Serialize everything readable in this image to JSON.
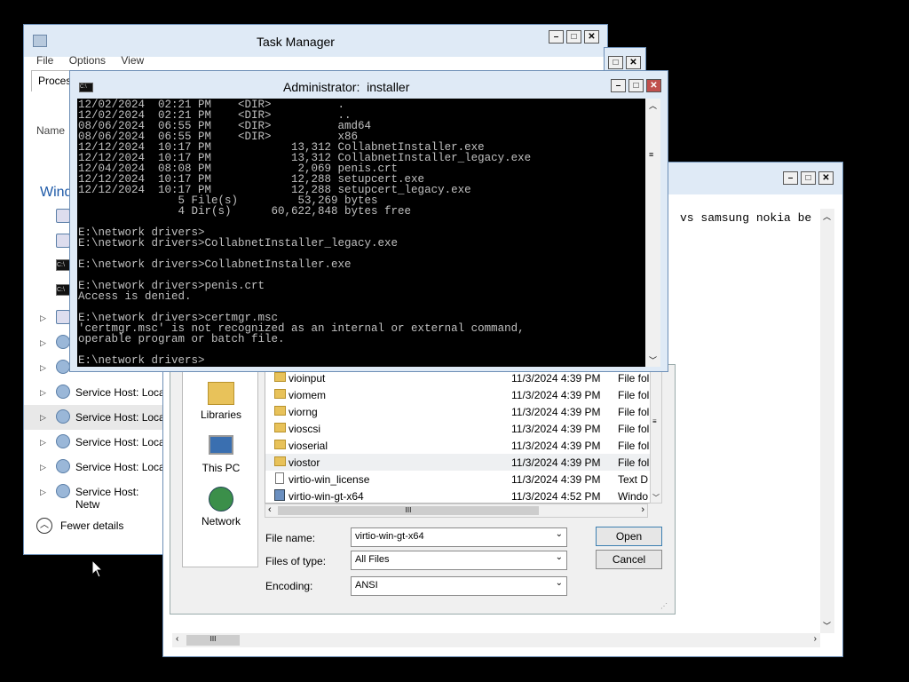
{
  "task_manager": {
    "title": "Task Manager",
    "menu": [
      "File",
      "Options",
      "View"
    ],
    "tab_partial": "Proces",
    "col_name": "Name",
    "group_partial": "Wind",
    "processes": [
      {
        "label": "Service Host: Loca"
      },
      {
        "label": "Service Host: Loca"
      },
      {
        "label": "Service Host: Loca"
      },
      {
        "label": "Service Host: Loca"
      },
      {
        "label": "Service Host: Netw"
      }
    ],
    "fewer_details": "Fewer details"
  },
  "notepad": {
    "text": "vs samsung nokia be"
  },
  "open_dialog": {
    "places": [
      {
        "label": "Libraries",
        "icon": "libraries-icon"
      },
      {
        "label": "This PC",
        "icon": "this-pc-icon"
      },
      {
        "label": "Network",
        "icon": "network-icon"
      }
    ],
    "files": [
      {
        "name": "vioinput",
        "date": "11/3/2024 4:39 PM",
        "type": "File fol",
        "icon": "folder"
      },
      {
        "name": "viomem",
        "date": "11/3/2024 4:39 PM",
        "type": "File fol",
        "icon": "folder"
      },
      {
        "name": "viorng",
        "date": "11/3/2024 4:39 PM",
        "type": "File fol",
        "icon": "folder"
      },
      {
        "name": "vioscsi",
        "date": "11/3/2024 4:39 PM",
        "type": "File fol",
        "icon": "folder"
      },
      {
        "name": "vioserial",
        "date": "11/3/2024 4:39 PM",
        "type": "File fol",
        "icon": "folder"
      },
      {
        "name": "viostor",
        "date": "11/3/2024 4:39 PM",
        "type": "File fol",
        "icon": "folder"
      },
      {
        "name": "virtio-win_license",
        "date": "11/3/2024 4:39 PM",
        "type": "Text D",
        "icon": "text-file"
      },
      {
        "name": "virtio-win-gt-x64",
        "date": "11/3/2024 4:52 PM",
        "type": "Windo",
        "icon": "installer"
      }
    ],
    "file_name_label": "File name:",
    "file_name_value": "virtio-win-gt-x64",
    "files_of_type_label": "Files of type:",
    "files_of_type_value": "All Files",
    "encoding_label": "Encoding:",
    "encoding_value": "ANSI",
    "open_label": "Open",
    "cancel_label": "Cancel"
  },
  "cmd": {
    "title": "Administrator:  installer",
    "lines": [
      "12/02/2024  02:21 PM    <DIR>          .",
      "12/02/2024  02:21 PM    <DIR>          ..",
      "08/06/2024  06:55 PM    <DIR>          amd64",
      "08/06/2024  06:55 PM    <DIR>          x86",
      "12/12/2024  10:17 PM            13,312 CollabnetInstaller.exe",
      "12/12/2024  10:17 PM            13,312 CollabnetInstaller_legacy.exe",
      "12/04/2024  08:08 PM             2,069 penis.crt",
      "12/12/2024  10:17 PM            12,288 setupcert.exe",
      "12/12/2024  10:17 PM            12,288 setupcert_legacy.exe",
      "               5 File(s)         53,269 bytes",
      "               4 Dir(s)      60,622,848 bytes free",
      "",
      "E:\\network drivers>",
      "E:\\network drivers>CollabnetInstaller_legacy.exe",
      "",
      "E:\\network drivers>CollabnetInstaller.exe",
      "",
      "E:\\network drivers>penis.crt",
      "Access is denied.",
      "",
      "E:\\network drivers>certmgr.msc",
      "'certmgr.msc' is not recognized as an internal or external command,",
      "operable program or batch file.",
      "",
      "E:\\network drivers>"
    ]
  }
}
